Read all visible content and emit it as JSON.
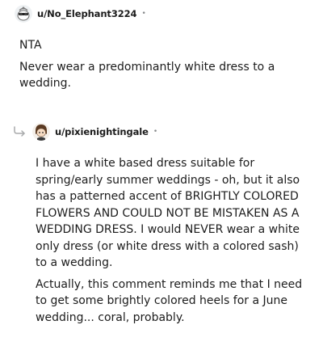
{
  "comments": [
    {
      "username": "u/No_Elephant3224",
      "separator": "•",
      "avatar_icon": "snoo-avatar-icon",
      "paragraphs": [
        "NTA",
        "Never wear a predominantly white dress to a wedding."
      ]
    },
    {
      "username": "u/pixienightingale",
      "separator": "•",
      "avatar_icon": "snoo-avatar-icon",
      "reply_icon": "reply-arrow-icon",
      "paragraphs": [
        "I have a white based dress suitable for spring/early summer weddings - oh, but it also has a patterned accent of BRIGHTLY COLORED FLOWERS AND COULD NOT BE MISTAKEN AS A WEDDING DRESS. I would NEVER wear a white only dress (or white dress with a colored sash) to a wedding.",
        "Actually, this comment reminds me that I need to get some brightly colored heels for a June wedding... coral, probably."
      ]
    }
  ]
}
